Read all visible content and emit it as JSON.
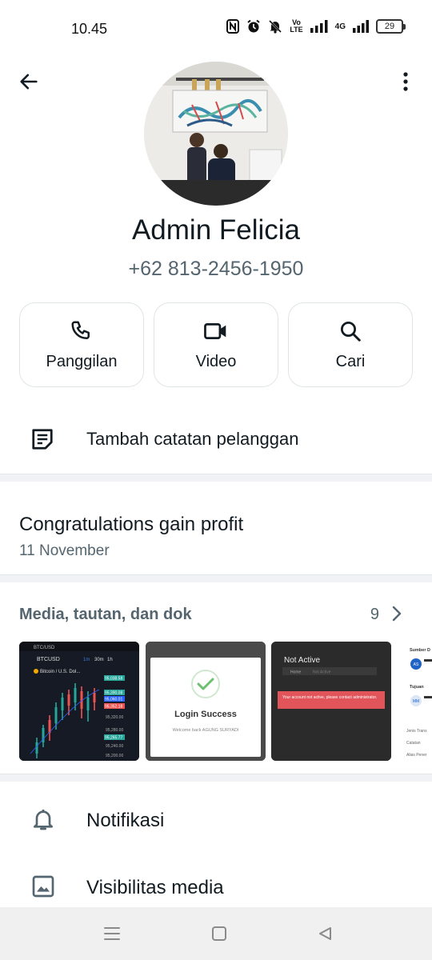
{
  "status_bar": {
    "time": "10.45",
    "volte_line1": "Vo",
    "volte_line2": "LTE",
    "network": "4G",
    "battery": "29"
  },
  "header": {
    "back_icon": "arrow-left-icon",
    "more_icon": "more-vertical-icon"
  },
  "contact": {
    "name": "Admin Felicia",
    "phone": "+62 813-2456-1950"
  },
  "actions": [
    {
      "label": "Panggilan",
      "icon": "phone-icon"
    },
    {
      "label": "Video",
      "icon": "video-icon"
    },
    {
      "label": "Cari",
      "icon": "search-icon"
    }
  ],
  "note": {
    "label": "Tambah catatan pelanggan",
    "icon": "note-icon"
  },
  "about": {
    "text": "Congratulations gain profit",
    "date": "11 November"
  },
  "media": {
    "title": "Media, tautan, dan dok",
    "count": "9",
    "thumbs": {
      "t1": {
        "symbol": "BTCUSD",
        "pair": "Bitcoin / U.S. Dol...",
        "intervals": [
          "1m",
          "30m",
          "1h"
        ],
        "prices": [
          "95,038.58",
          "95,060.01",
          "95,390.08",
          "95,352.18",
          "95,320.00",
          "95,280.00",
          "95,265.77",
          "95,240.00",
          "95,200.00"
        ]
      },
      "t2": {
        "title": "Login Success",
        "subtitle": "Welcome back AGUNG SURYADI"
      },
      "t3": {
        "title": "Not Active",
        "breadcrumb_home": "Home",
        "breadcrumb_page": "Not Active",
        "alert": "Your account not active, please contact administrator."
      },
      "t4": {
        "source_label": "Sumber D",
        "initials_1": "AS",
        "dest_label": "Tujuan",
        "initials_2": "MM",
        "row1": "Jenis Trans",
        "row2": "Catatan",
        "row3": "Alias Pener"
      }
    }
  },
  "list": [
    {
      "label": "Notifikasi",
      "icon": "bell-icon"
    },
    {
      "label": "Visibilitas media",
      "icon": "image-icon"
    }
  ],
  "colors": {
    "text_primary": "#111b21",
    "text_secondary": "#54656f",
    "divider": "#f0f2f5",
    "alert_red": "#e0545a"
  }
}
